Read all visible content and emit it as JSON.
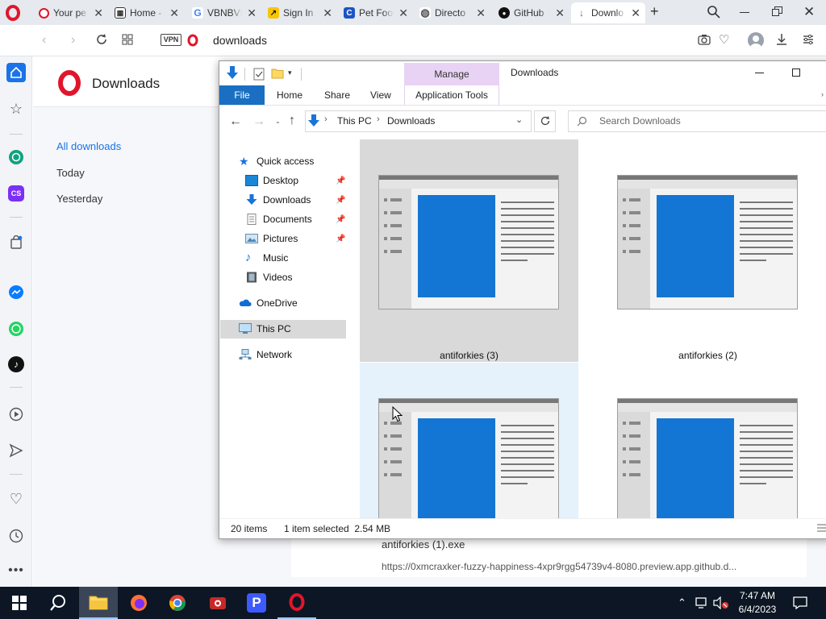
{
  "browser": {
    "tabs": [
      {
        "label": "Your pe",
        "icon_color": "#e0162b",
        "icon_glyph": "O"
      },
      {
        "label": "Home -",
        "icon_color": "#444444",
        "icon_glyph": "▦"
      },
      {
        "label": "VBNBVI",
        "icon_color": "#4285f4",
        "icon_glyph": "G"
      },
      {
        "label": "Sign In",
        "icon_color": "#f7c600",
        "icon_glyph": "↗"
      },
      {
        "label": "Pet Foo",
        "icon_color": "#1a55c7",
        "icon_glyph": "C"
      },
      {
        "label": "Directo",
        "icon_color": "#555555",
        "icon_glyph": "◍"
      },
      {
        "label": "GitHub",
        "icon_color": "#111111",
        "icon_glyph": "●"
      },
      {
        "label": "Downlo",
        "icon_color": "#5a6a7e",
        "icon_glyph": "↓"
      }
    ],
    "new_tab": "+",
    "address": "downloads",
    "vpn_label": "VPN"
  },
  "downloads_page": {
    "title": "Downloads",
    "filters": [
      "All downloads",
      "Today",
      "Yesterday"
    ],
    "item_name": "antiforkies (1).exe",
    "item_url": "https://0xmcraxker-fuzzy-happiness-4xpr9rgg54739v4-8080.preview.app.github.d..."
  },
  "explorer": {
    "manage_label": "Manage",
    "window_title": "Downloads",
    "ribbon_tabs": [
      "File",
      "Home",
      "Share",
      "View",
      "Application Tools"
    ],
    "path": [
      "This PC",
      "Downloads"
    ],
    "search_placeholder": "Search Downloads",
    "nav": {
      "quick_access": "Quick access",
      "desktop": "Desktop",
      "downloads": "Downloads",
      "documents": "Documents",
      "pictures": "Pictures",
      "music": "Music",
      "videos": "Videos",
      "onedrive": "OneDrive",
      "this_pc": "This PC",
      "network": "Network"
    },
    "files": [
      {
        "name": "antiforkies (3)"
      },
      {
        "name": "antiforkies (2)"
      },
      {
        "name": ""
      },
      {
        "name": ""
      }
    ],
    "status_items": "20 items",
    "status_selected": "1 item selected  2.54 MB"
  },
  "taskbar": {
    "time": "7:47 AM",
    "date": "6/4/2023"
  },
  "colors": {
    "accent_blue": "#1a73e8",
    "opera_red": "#e0162b",
    "file_tab": "#1a6fc2",
    "manage_bg": "#e8d3f4",
    "thumb_blue": "#1476d4"
  }
}
